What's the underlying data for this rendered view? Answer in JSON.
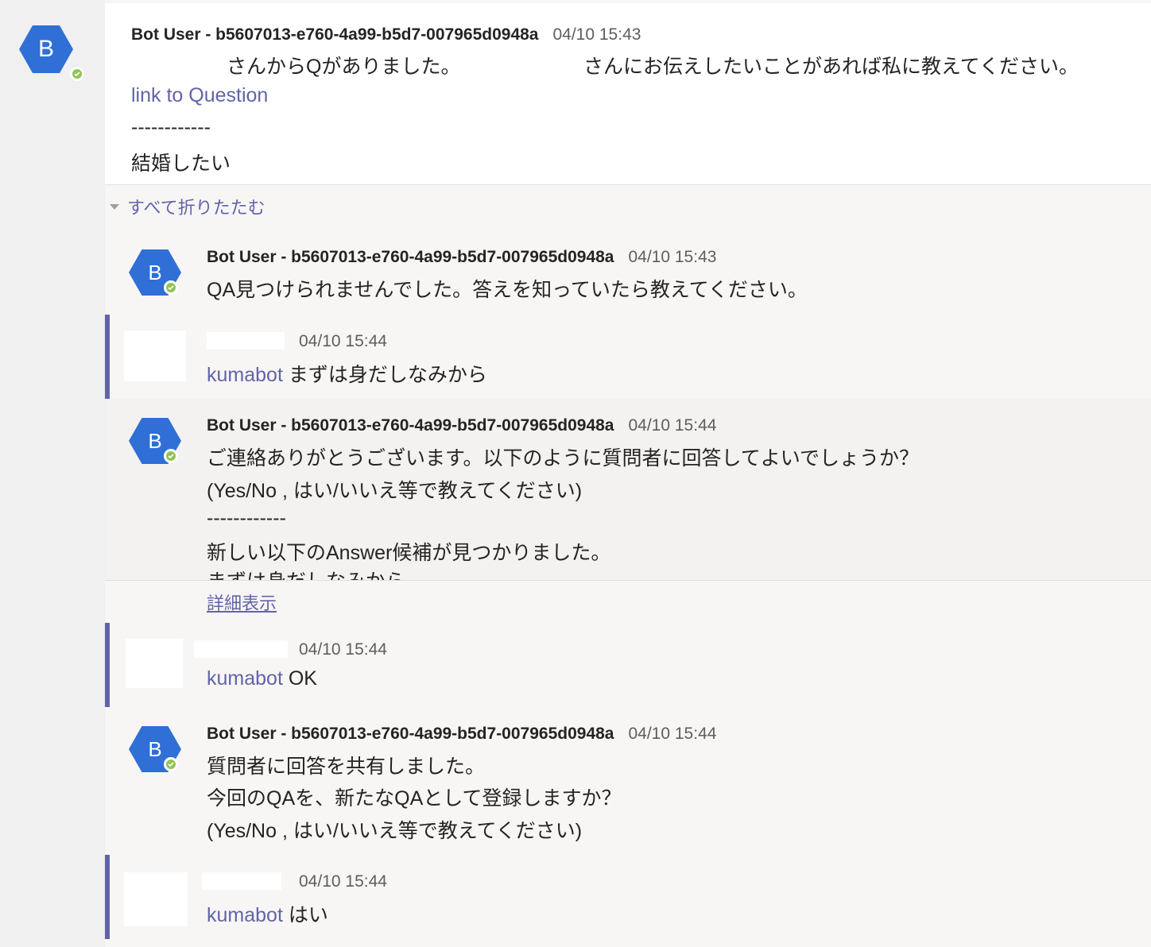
{
  "root": {
    "avatar_letter": "B",
    "sender": "Bot User - b5607013-e760-4a99-b5d7-007965d0948a",
    "time": "04/10 15:43",
    "line1_part1": "さんからQがありました。",
    "line1_part2": "さんにお伝えしたいことがあれば私に教えてください。",
    "link_text": "link to Question",
    "divider": "------------",
    "question": "結婚したい"
  },
  "collapse_all": "すべて折りたたむ",
  "replies": [
    {
      "sender": "Bot User - b5607013-e760-4a99-b5d7-007965d0948a",
      "time": "04/10 15:43",
      "avatar_letter": "B",
      "line1": "QA見つけられませんでした。答えを知っていたら教えてください。"
    },
    {
      "time": "04/10 15:44",
      "mention": "kumabot",
      "text": "まずは身だしなみから"
    },
    {
      "sender": "Bot User - b5607013-e760-4a99-b5d7-007965d0948a",
      "time": "04/10 15:44",
      "avatar_letter": "B",
      "line1": "ご連絡ありがとうございます。以下のように質問者に回答してよいでしょうか？",
      "line2": "(Yes/No , はい/いいえ等で教えてください)",
      "line3": "------------",
      "line4": "新しい以下のAnswer候補が見つかりました。",
      "line5": "まずは身だしなみから",
      "see_more": "詳細表示"
    },
    {
      "time": "04/10 15:44",
      "mention": "kumabot",
      "text": "OK"
    },
    {
      "sender": "Bot User - b5607013-e760-4a99-b5d7-007965d0948a",
      "time": "04/10 15:44",
      "avatar_letter": "B",
      "line1": "質問者に回答を共有しました。",
      "line2": "今回のQAを、新たなQAとして登録しますか？",
      "line3": "(Yes/No , はい/いいえ等で教えてください)"
    },
    {
      "time": "04/10 15:44",
      "mention": "kumabot",
      "text": "はい"
    }
  ],
  "colors": {
    "accent": "#6264a7",
    "bot_avatar": "#2f6fd6",
    "presence": "#92c353"
  }
}
